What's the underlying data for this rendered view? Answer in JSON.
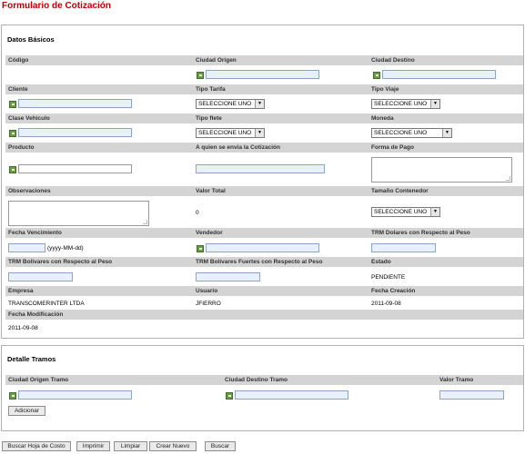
{
  "page": {
    "title": "Formulario de Cotización"
  },
  "datos_basicos": {
    "legend": "Datos Básicos",
    "labels": {
      "codigo": "Código",
      "ciudad_origen": "Ciudad Origen",
      "ciudad_destino": "Ciudad Destino",
      "cliente": "Cliente",
      "tipo_tarifa": "Tipo Tarifa",
      "tipo_viaje": "Tipo Viaje",
      "clase_vehiculo": "Clase Vehiculo",
      "tipo_flete": "Tipo flete",
      "moneda": "Moneda",
      "producto": "Producto",
      "a_quien": "A quien se envia la Cotización",
      "forma_pago": "Forma de Pago",
      "observaciones": "Observaciones",
      "valor_total": "Valor Total",
      "tamano_contenedor": "Tamaño Contenedor",
      "fecha_vencimiento": "Fecha Vencimiento",
      "vendedor": "Vendedor",
      "trm_dolares": "TRM Dolares con Respecto al Peso",
      "trm_bolivares": "TRM Bolivares con Respecto al Peso",
      "trm_bolivares_fuertes": "TRM Bolivares Fuertes con Respecto al Peso",
      "estado": "Estado",
      "empresa": "Empresa",
      "usuario": "Usuario",
      "fecha_creacion": "Fecha Creación",
      "fecha_modificacion": "Fecha Modificación"
    },
    "values": {
      "tipo_tarifa": "SELECCIONE UNO",
      "tipo_viaje": "SELECCIONE UNO",
      "tipo_flete": "SELECCIONE UNO",
      "moneda": "SELECCIONE UNO",
      "tamano_contenedor": "SELECCIONE UNO",
      "valor_total": "0",
      "fecha_hint": "(yyyy-MM-dd)",
      "estado": "PENDIENTE",
      "empresa": "TRANSCOMERINTER LTDA",
      "usuario": "JFIERRO",
      "fecha_creacion": "2011-09-08",
      "fecha_modificacion": "2011-09-08"
    }
  },
  "detalle_tramos": {
    "legend": "Detalle Tramos",
    "labels": {
      "ciudad_origen_tramo": "Ciudad Origen Tramo",
      "ciudad_destino_tramo": "Ciudad Destino Tramo",
      "valor_tramo": "Valor Tramo"
    },
    "add_button": "Adicionar"
  },
  "footer_buttons": {
    "buscar_hoja": "Buscar Hoja de Costo",
    "imprimir": "Imprimir",
    "limpiar": "Limpiar",
    "crear_nuevo": "Crear Nuevo",
    "buscar": "Buscar"
  },
  "icons": {
    "lookup": "lookup-icon",
    "dropdown": "chevron-down-icon"
  },
  "colors": {
    "title": "#c00000",
    "header_band": "#d4d4d4",
    "input_fill": "#e8f0fb",
    "input_border": "#8aa5c6",
    "lookup_icon": "#6a9a4a"
  }
}
